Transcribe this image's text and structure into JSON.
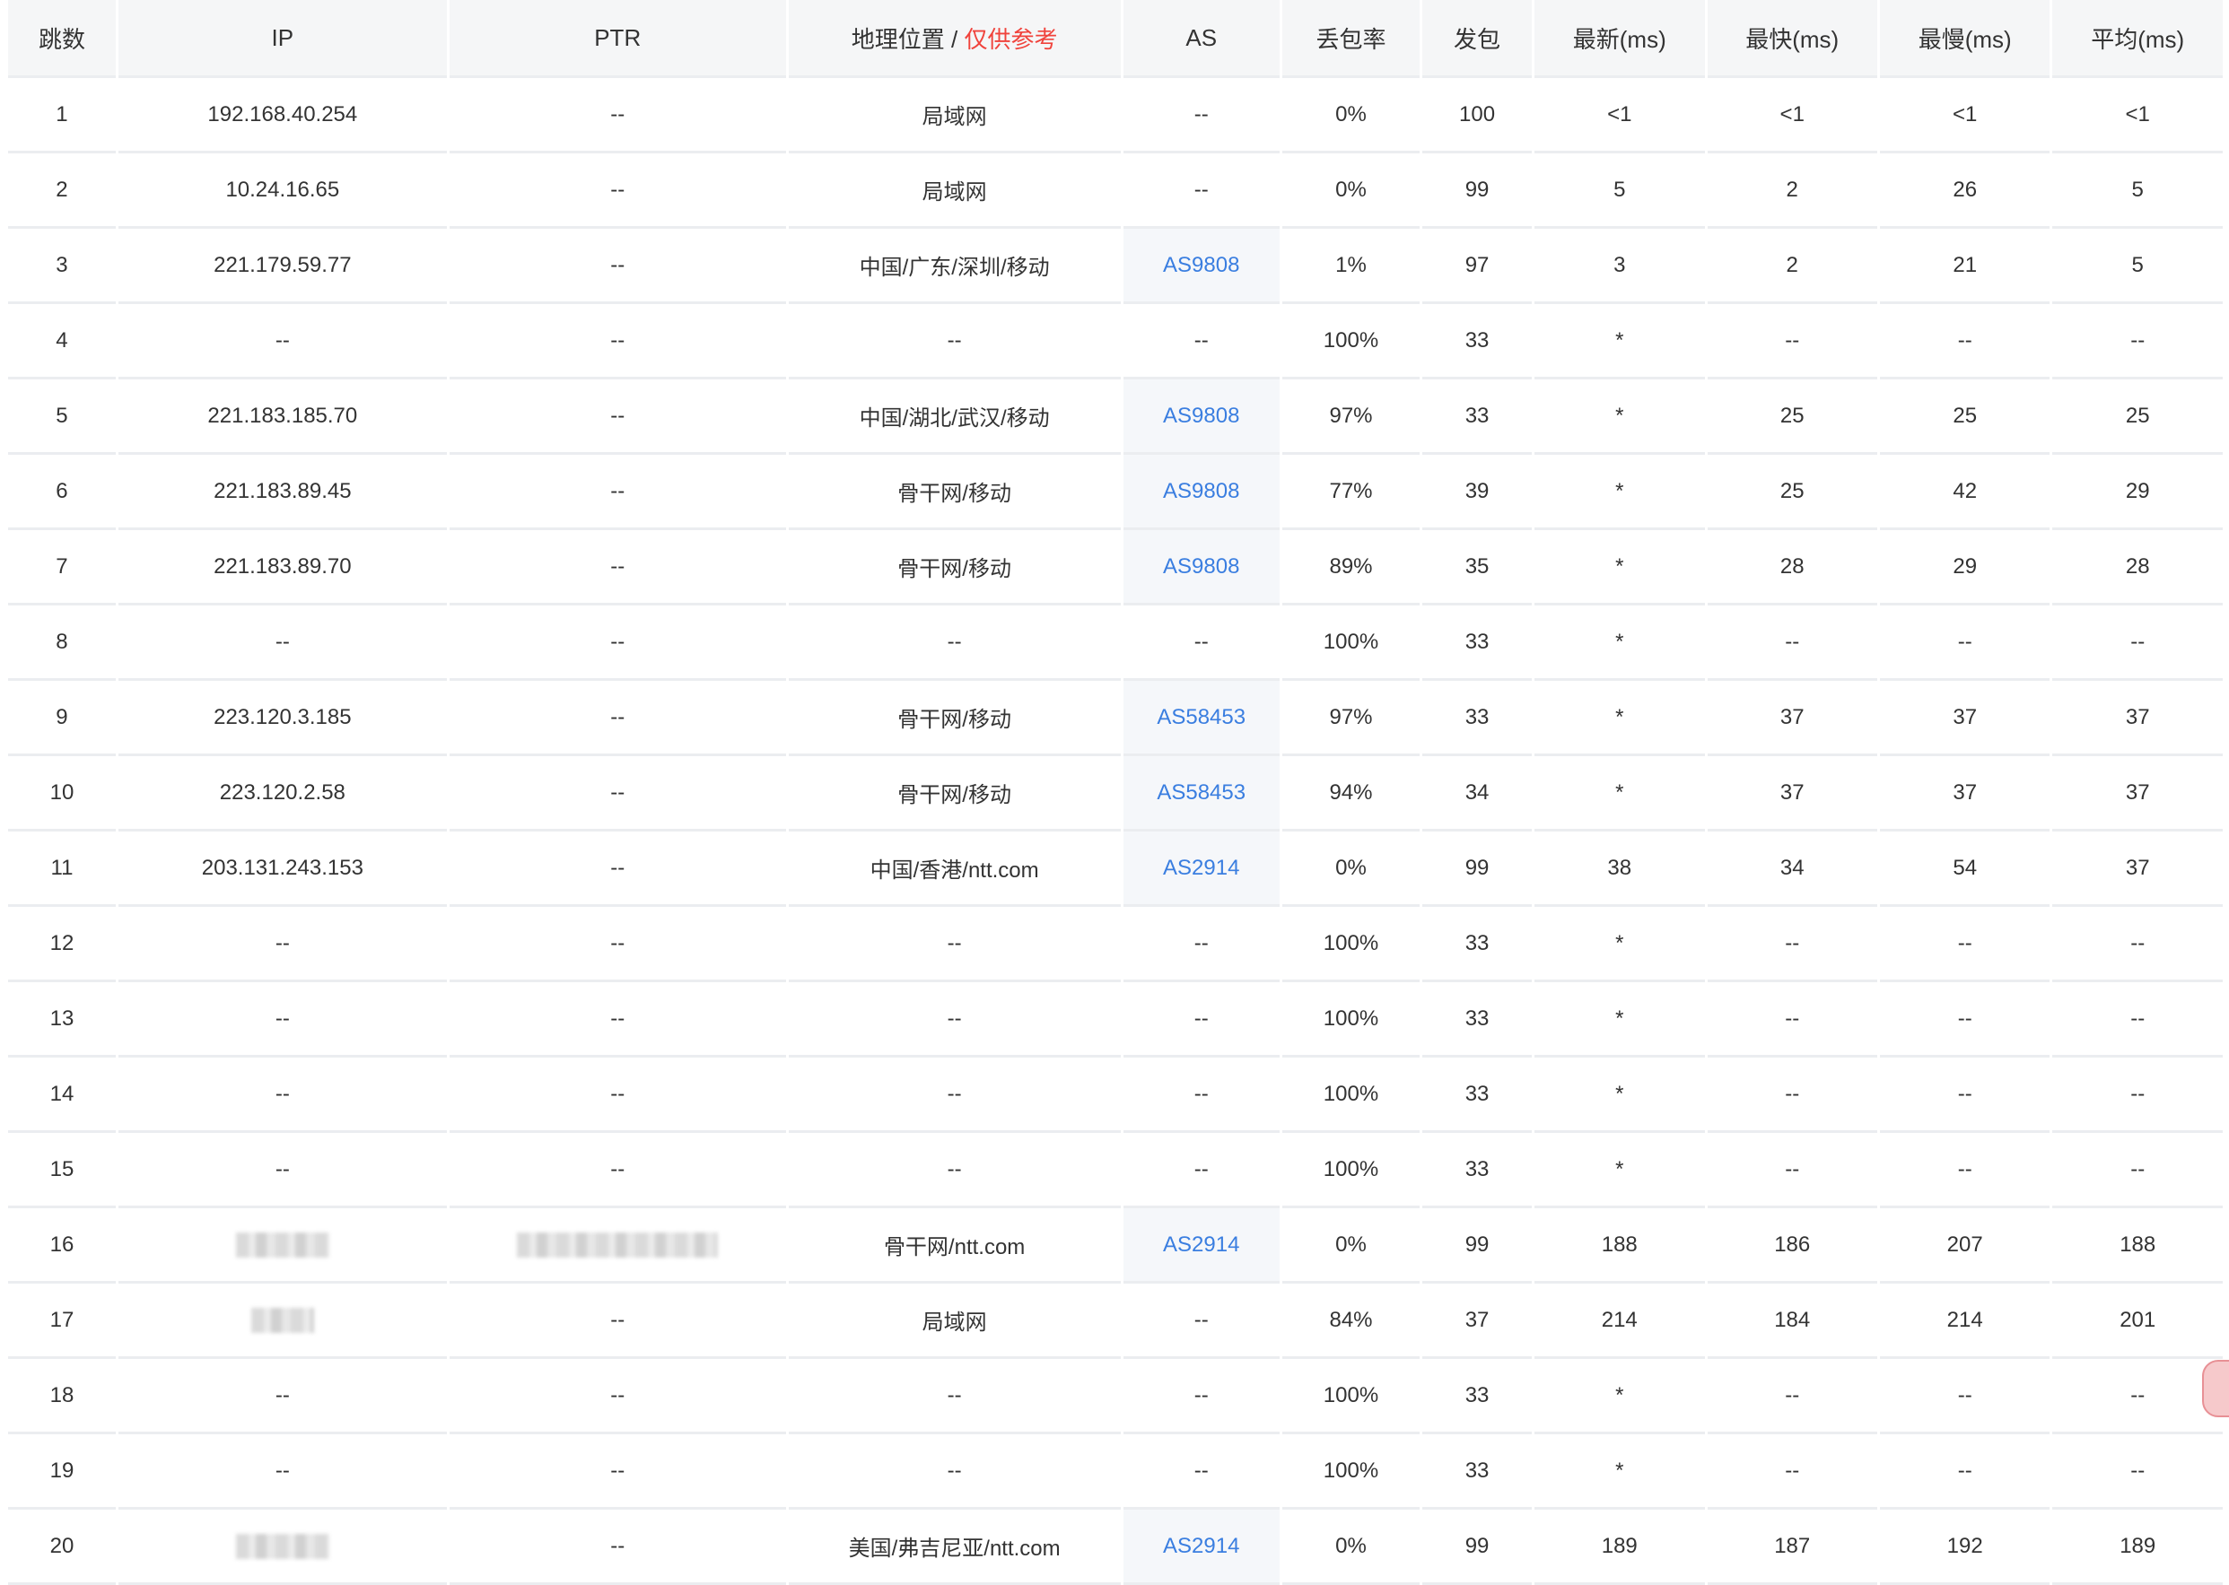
{
  "headers": {
    "hop": "跳数",
    "ip": "IP",
    "ptr": "PTR",
    "geo": "地理位置",
    "geo_sep": " / ",
    "geo_note": "仅供参考",
    "as": "AS",
    "loss": "丢包率",
    "sent": "发包",
    "last": "最新(ms)",
    "best": "最快(ms)",
    "worst": "最慢(ms)",
    "avg": "平均(ms)"
  },
  "colors": {
    "accent_link": "#3a7ee0",
    "note_red": "#f0433c",
    "header_bg": "#f5f6f7"
  },
  "rows": [
    {
      "hop": "1",
      "ip": "192.168.40.254",
      "ptr": "--",
      "geo": "局域网",
      "as": "--",
      "loss": "0%",
      "sent": "100",
      "last": "<1",
      "best": "<1",
      "worst": "<1",
      "avg": "<1"
    },
    {
      "hop": "2",
      "ip": "10.24.16.65",
      "ptr": "--",
      "geo": "局域网",
      "as": "--",
      "loss": "0%",
      "sent": "99",
      "last": "5",
      "best": "2",
      "worst": "26",
      "avg": "5"
    },
    {
      "hop": "3",
      "ip": "221.179.59.77",
      "ptr": "--",
      "geo": "中国/广东/深圳/移动",
      "as": "AS9808",
      "loss": "1%",
      "sent": "97",
      "last": "3",
      "best": "2",
      "worst": "21",
      "avg": "5"
    },
    {
      "hop": "4",
      "ip": "--",
      "ptr": "--",
      "geo": "--",
      "as": "--",
      "loss": "100%",
      "sent": "33",
      "last": "*",
      "best": "--",
      "worst": "--",
      "avg": "--"
    },
    {
      "hop": "5",
      "ip": "221.183.185.70",
      "ptr": "--",
      "geo": "中国/湖北/武汉/移动",
      "as": "AS9808",
      "loss": "97%",
      "sent": "33",
      "last": "*",
      "best": "25",
      "worst": "25",
      "avg": "25"
    },
    {
      "hop": "6",
      "ip": "221.183.89.45",
      "ptr": "--",
      "geo": "骨干网/移动",
      "as": "AS9808",
      "loss": "77%",
      "sent": "39",
      "last": "*",
      "best": "25",
      "worst": "42",
      "avg": "29"
    },
    {
      "hop": "7",
      "ip": "221.183.89.70",
      "ptr": "--",
      "geo": "骨干网/移动",
      "as": "AS9808",
      "loss": "89%",
      "sent": "35",
      "last": "*",
      "best": "28",
      "worst": "29",
      "avg": "28"
    },
    {
      "hop": "8",
      "ip": "--",
      "ptr": "--",
      "geo": "--",
      "as": "--",
      "loss": "100%",
      "sent": "33",
      "last": "*",
      "best": "--",
      "worst": "--",
      "avg": "--"
    },
    {
      "hop": "9",
      "ip": "223.120.3.185",
      "ptr": "--",
      "geo": "骨干网/移动",
      "as": "AS58453",
      "loss": "97%",
      "sent": "33",
      "last": "*",
      "best": "37",
      "worst": "37",
      "avg": "37"
    },
    {
      "hop": "10",
      "ip": "223.120.2.58",
      "ptr": "--",
      "geo": "骨干网/移动",
      "as": "AS58453",
      "loss": "94%",
      "sent": "34",
      "last": "*",
      "best": "37",
      "worst": "37",
      "avg": "37"
    },
    {
      "hop": "11",
      "ip": "203.131.243.153",
      "ptr": "--",
      "geo": "中国/香港/ntt.com",
      "as": "AS2914",
      "loss": "0%",
      "sent": "99",
      "last": "38",
      "best": "34",
      "worst": "54",
      "avg": "37"
    },
    {
      "hop": "12",
      "ip": "--",
      "ptr": "--",
      "geo": "--",
      "as": "--",
      "loss": "100%",
      "sent": "33",
      "last": "*",
      "best": "--",
      "worst": "--",
      "avg": "--"
    },
    {
      "hop": "13",
      "ip": "--",
      "ptr": "--",
      "geo": "--",
      "as": "--",
      "loss": "100%",
      "sent": "33",
      "last": "*",
      "best": "--",
      "worst": "--",
      "avg": "--"
    },
    {
      "hop": "14",
      "ip": "--",
      "ptr": "--",
      "geo": "--",
      "as": "--",
      "loss": "100%",
      "sent": "33",
      "last": "*",
      "best": "--",
      "worst": "--",
      "avg": "--"
    },
    {
      "hop": "15",
      "ip": "--",
      "ptr": "--",
      "geo": "--",
      "as": "--",
      "loss": "100%",
      "sent": "33",
      "last": "*",
      "best": "--",
      "worst": "--",
      "avg": "--"
    },
    {
      "hop": "16",
      "ip": "",
      "ip_redacted": "wide",
      "ptr": "",
      "ptr_redacted": "wide",
      "geo": "骨干网/ntt.com",
      "as": "AS2914",
      "loss": "0%",
      "sent": "99",
      "last": "188",
      "best": "186",
      "worst": "207",
      "avg": "188"
    },
    {
      "hop": "17",
      "ip": "",
      "ip_redacted": "short",
      "ptr": "--",
      "geo": "局域网",
      "as": "--",
      "loss": "84%",
      "sent": "37",
      "last": "214",
      "best": "184",
      "worst": "214",
      "avg": "201"
    },
    {
      "hop": "18",
      "ip": "--",
      "ptr": "--",
      "geo": "--",
      "as": "--",
      "loss": "100%",
      "sent": "33",
      "last": "*",
      "best": "--",
      "worst": "--",
      "avg": "--"
    },
    {
      "hop": "19",
      "ip": "--",
      "ptr": "--",
      "geo": "--",
      "as": "--",
      "loss": "100%",
      "sent": "33",
      "last": "*",
      "best": "--",
      "worst": "--",
      "avg": "--"
    },
    {
      "hop": "20",
      "ip": "",
      "ip_redacted": "wide",
      "ptr": "--",
      "geo": "美国/弗吉尼亚/ntt.com",
      "as": "AS2914",
      "loss": "0%",
      "sent": "99",
      "last": "189",
      "best": "187",
      "worst": "192",
      "avg": "189"
    }
  ]
}
